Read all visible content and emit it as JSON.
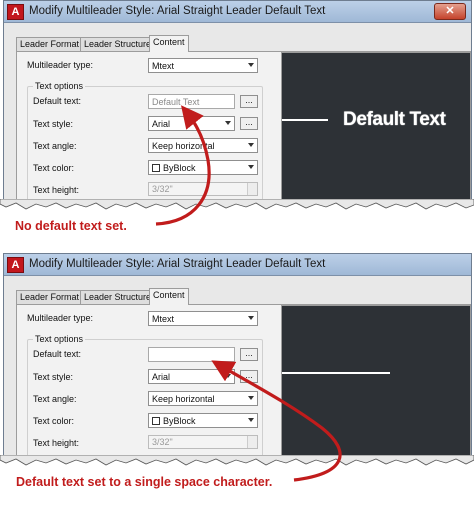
{
  "window": {
    "title": "Modify Multileader Style: Arial Straight Leader Default Text",
    "app_icon": "autocad-icon",
    "close_label": "✕"
  },
  "tabs": [
    "Leader Format",
    "Leader Structure",
    "Content"
  ],
  "active_tab": "Content",
  "fields": {
    "multileader_type_label": "Multileader type:",
    "multileader_type_value": "Mtext",
    "text_options_label": "Text options",
    "default_text_label": "Default text:",
    "browse_label": "...",
    "text_style_label": "Text style:",
    "text_style_value": "Arial",
    "text_angle_label": "Text angle:",
    "text_angle_value": "Keep horizontal",
    "text_color_label": "Text color:",
    "text_color_value": "ByBlock",
    "text_height_label": "Text height:",
    "text_height_value": "3/32\""
  },
  "screenshots": [
    {
      "default_text_value": "Default Text",
      "preview_text": "Default Text",
      "caption": "No default text set."
    },
    {
      "default_text_value": "",
      "preview_text": "",
      "caption": "Default text set to a single space character."
    }
  ],
  "colors": {
    "preview_background": "#2d3136",
    "annotation": "#c11c1c",
    "titlebar": "#9fb8d6"
  }
}
